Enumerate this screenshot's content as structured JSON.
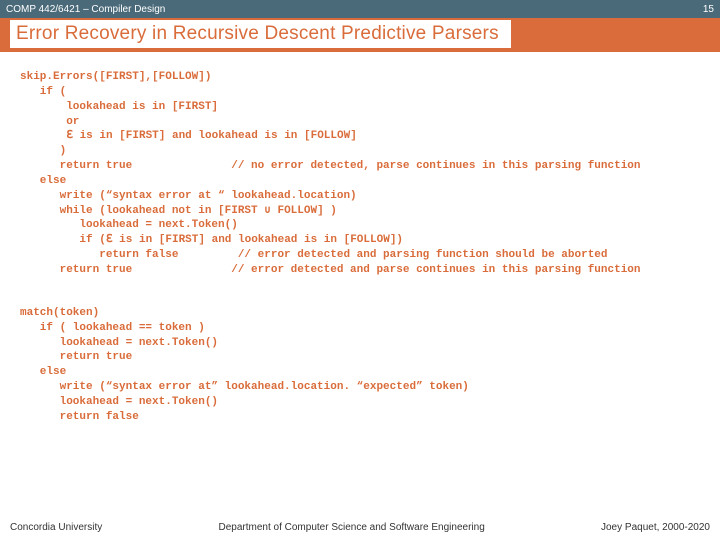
{
  "topbar": {
    "course": "COMP 442/6421 – Compiler Design",
    "page": "15"
  },
  "title": "Error Recovery in Recursive Descent Predictive Parsers",
  "code1": "skip.Errors([FIRST],[FOLLOW])\n   if (\n       lookahead is in [FIRST]\n       or\n       ℇ is in [FIRST] and lookahead is in [FOLLOW]\n      )\n      return true               // no error detected, parse continues in this parsing function\n   else\n      write (“syntax error at “ lookahead.location)\n      while (lookahead not in [FIRST ∪ FOLLOW] )\n         lookahead = next.Token()\n         if (ℇ is in [FIRST] and lookahead is in [FOLLOW])\n            return false         // error detected and parsing function should be aborted\n      return true               // error detected and parse continues in this parsing function",
  "code2": "match(token)\n   if ( lookahead == token )\n      lookahead = next.Token()\n      return true\n   else\n      write (“syntax error at” lookahead.location. “expected” token)\n      lookahead = next.Token()\n      return false",
  "footer": {
    "left": "Concordia University",
    "center": "Department of Computer Science and Software Engineering",
    "right": "Joey Paquet, 2000-2020"
  }
}
